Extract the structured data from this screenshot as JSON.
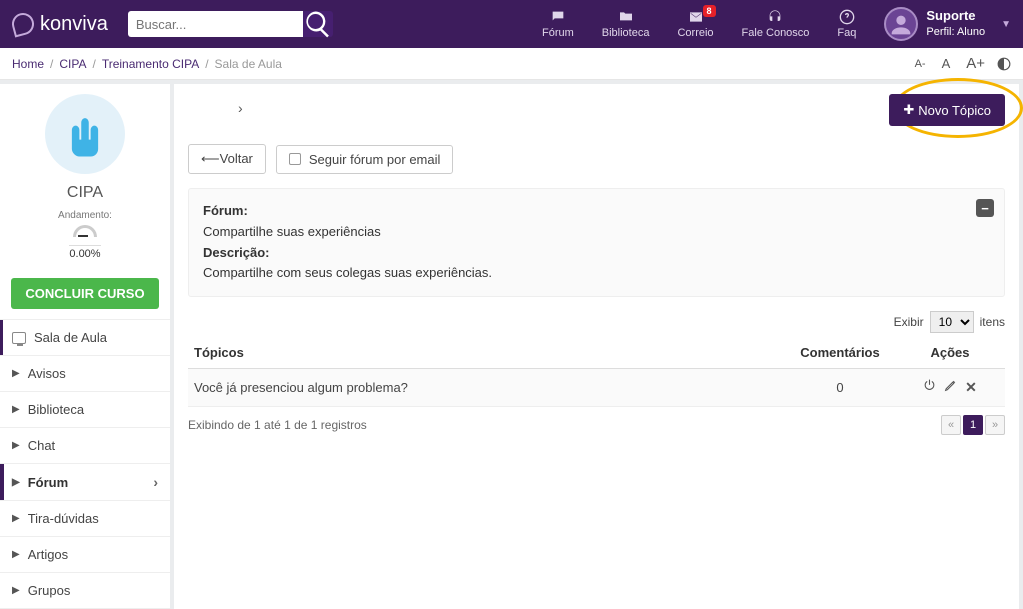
{
  "brand": {
    "name": "konviva"
  },
  "search": {
    "placeholder": "Buscar..."
  },
  "nav": {
    "forum": "Fórum",
    "biblioteca": "Biblioteca",
    "correio": "Correio",
    "correio_badge": "8",
    "fale": "Fale Conosco",
    "faq": "Faq"
  },
  "user": {
    "name": "Suporte",
    "profile": "Perfil: Aluno"
  },
  "breadcrumb": {
    "home": "Home",
    "l1": "CIPA",
    "l2": "Treinamento CIPA",
    "last": "Sala de Aula"
  },
  "fontbar": {
    "small": "A-",
    "med": "A",
    "large": "A+"
  },
  "sidebar": {
    "course": "CIPA",
    "progress_label": "Andamento:",
    "progress_pct": "0.00%",
    "conclude": "CONCLUIR CURSO",
    "items": [
      {
        "label": "Sala de Aula",
        "kind": "monitor",
        "active": true
      },
      {
        "label": "Avisos"
      },
      {
        "label": "Biblioteca"
      },
      {
        "label": "Chat"
      },
      {
        "label": "Fórum",
        "forum": true,
        "chev": true
      },
      {
        "label": "Tira-dúvidas"
      },
      {
        "label": "Artigos"
      },
      {
        "label": "Grupos"
      }
    ]
  },
  "main": {
    "novo": "Novo Tópico",
    "back": "Voltar",
    "follow": "Seguir fórum por email",
    "forum_title_label": "Fórum:",
    "forum_title": "Compartilhe suas experiências",
    "desc_label": "Descrição:",
    "desc": "Compartilhe com seus colegas suas experiências.",
    "exibir": "Exibir",
    "exibir_val": "10",
    "itens": "itens",
    "col_topicos": "Tópicos",
    "col_coment": "Comentários",
    "col_acoes": "Ações",
    "rows": [
      {
        "title": "Você já presenciou algum problema?",
        "comments": "0"
      }
    ],
    "pager_info": "Exibindo de 1 até 1 de 1 registros",
    "page": "1"
  }
}
